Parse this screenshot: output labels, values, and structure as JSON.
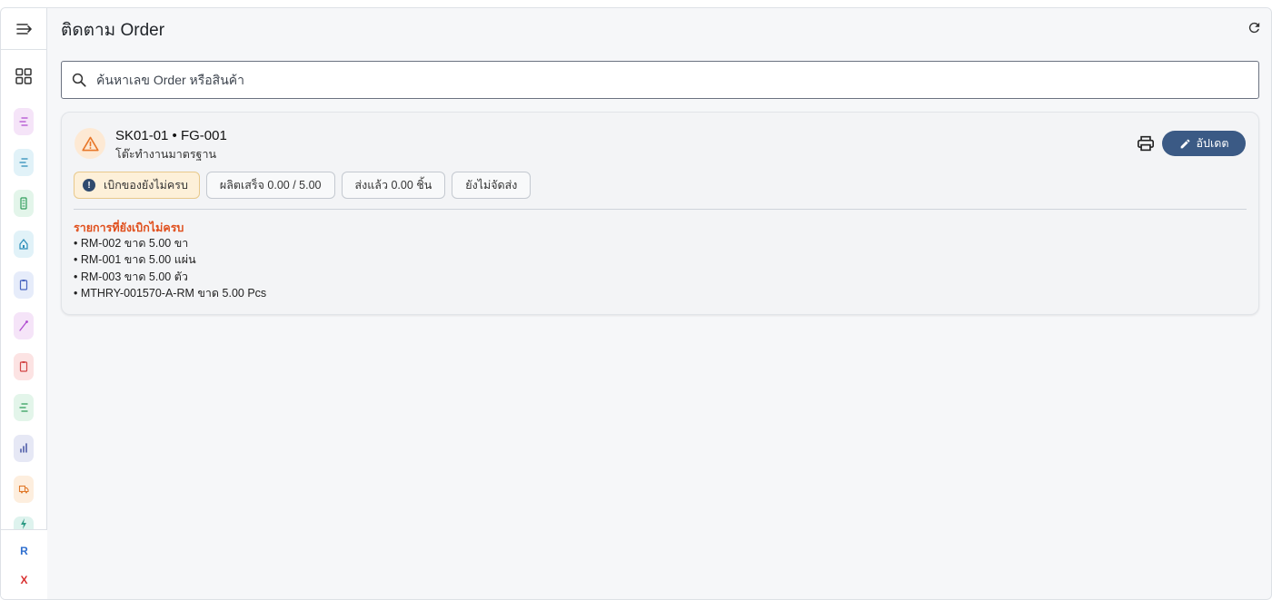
{
  "header": {
    "title": "ติดตาม Order"
  },
  "search": {
    "placeholder": "ค้นหาเลข Order หรือสินค้า"
  },
  "sidebar": {
    "items": [
      {
        "icon": "list-icon",
        "bg": "#f5e4f8",
        "fg": "#b04bd0"
      },
      {
        "icon": "list-icon",
        "bg": "#e1f2f8",
        "fg": "#2a8db8"
      },
      {
        "icon": "device-icon",
        "bg": "#e3f5ea",
        "fg": "#2e9d5a"
      },
      {
        "icon": "home-icon",
        "bg": "#e1f2f8",
        "fg": "#2a8db8"
      },
      {
        "icon": "clipboard-icon",
        "bg": "#e6ecfa",
        "fg": "#4a66c0"
      },
      {
        "icon": "wand-icon",
        "bg": "#f5e4f8",
        "fg": "#b04bd0"
      },
      {
        "icon": "clipboard-icon",
        "bg": "#fce3e3",
        "fg": "#d24646"
      },
      {
        "icon": "list-icon",
        "bg": "#e3f5ea",
        "fg": "#2e9d5a"
      },
      {
        "icon": "chart-icon",
        "bg": "#e6e8f5",
        "fg": "#3a4a9e"
      },
      {
        "icon": "truck-icon",
        "bg": "#fdeede",
        "fg": "#e0792a"
      },
      {
        "icon": "bolt-icon",
        "bg": "#def3ee",
        "fg": "#2a9a84"
      }
    ],
    "bottom": [
      {
        "label": "R",
        "color": "#2f6fcf"
      },
      {
        "label": "X",
        "color": "#d93030"
      }
    ]
  },
  "order": {
    "title": "SK01-01 • FG-001",
    "product": "โต๊ะทำงานมาตรฐาน",
    "update_label": "อัปเดต",
    "chips": [
      {
        "label": "เบิกของยังไม่ครบ",
        "type": "warning"
      },
      {
        "label": "ผลิตเสร็จ 0.00 / 5.00"
      },
      {
        "label": "ส่งแล้ว 0.00 ชิ้น"
      },
      {
        "label": "ยังไม่จัดส่ง"
      }
    ],
    "missing_title": "รายการที่ยังเบิกไม่ครบ",
    "missing_items": [
      "• RM-002 ขาด 5.00 ขา",
      "• RM-001 ขาด 5.00 แผ่น",
      "• RM-003 ขาด 5.00 ตัว",
      "• MTHRY-001570-A-RM ขาด 5.00 Pcs"
    ]
  }
}
